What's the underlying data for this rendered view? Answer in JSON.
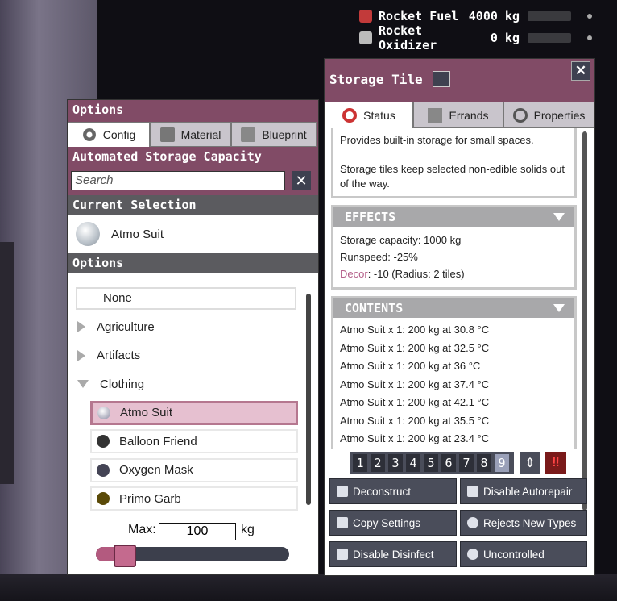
{
  "resources": [
    {
      "name": "Rocket Fuel",
      "value": "4000 kg",
      "icon": "rocket-fuel-icon"
    },
    {
      "name": "Rocket Oxidizer",
      "value": "0 kg",
      "icon": "rocket-oxidizer-icon"
    }
  ],
  "options_panel": {
    "title": "Options",
    "tabs": [
      {
        "label": "Config",
        "icon": "gear-icon"
      },
      {
        "label": "Material",
        "icon": "material-icon"
      },
      {
        "label": "Blueprint",
        "icon": "blueprint-icon"
      }
    ],
    "section_title": "Automated Storage Capacity",
    "search_placeholder": "Search",
    "current_selection_header": "Current Selection",
    "current_selection": "Atmo Suit",
    "options_header": "Options",
    "list": {
      "none": "None",
      "categories": [
        {
          "label": "Agriculture",
          "expanded": false
        },
        {
          "label": "Artifacts",
          "expanded": false
        },
        {
          "label": "Clothing",
          "expanded": true
        }
      ],
      "clothing_items": [
        {
          "label": "Atmo Suit",
          "selected": true,
          "color": "#c8d0d8"
        },
        {
          "label": "Balloon Friend",
          "selected": false,
          "color": "#444"
        },
        {
          "label": "Oxygen Mask",
          "selected": false,
          "color": "#556"
        },
        {
          "label": "Primo Garb",
          "selected": false,
          "color": "#6a5a10"
        }
      ]
    },
    "max_label": "Max:",
    "max_value": "100",
    "max_unit": "kg",
    "slider_level": 0.1
  },
  "storage_tile": {
    "title": "Storage Tile",
    "tabs": [
      {
        "label": "Status",
        "icon": "lifebuoy-icon"
      },
      {
        "label": "Errands",
        "icon": "errands-icon"
      },
      {
        "label": "Properties",
        "icon": "magnifier-icon"
      }
    ],
    "description_1": "Provides built-in storage for small spaces.",
    "description_2": "Storage tiles keep selected non-edible solids out of the way.",
    "effects_header": "EFFECTS",
    "effects": {
      "capacity": "Storage capacity: 1000 kg",
      "runspeed": "Runspeed: -25%",
      "decor_label": "Decor",
      "decor_value": ": -10 (Radius: 2 tiles)"
    },
    "contents_header": "CONTENTS",
    "contents": [
      "Atmo Suit x 1: 200 kg at 30.8 °C",
      "Atmo Suit x 1: 200 kg at 32.5 °C",
      "Atmo Suit x 1: 200 kg at 36 °C",
      "Atmo Suit x 1: 200 kg at 37.4 °C",
      "Atmo Suit x 1: 200 kg at 42.1 °C",
      "Atmo Suit x 1: 200 kg at 35.5 °C",
      "Atmo Suit x 1: 200 kg at 23.4 °C"
    ],
    "priorities": [
      "1",
      "2",
      "3",
      "4",
      "5",
      "6",
      "7",
      "8",
      "9"
    ],
    "selected_priority": "9",
    "actions": [
      {
        "label": "Deconstruct",
        "icon": "deconstruct-icon"
      },
      {
        "label": "Disable Autorepair",
        "icon": "wrench-icon"
      },
      {
        "label": "Copy Settings",
        "icon": "copy-icon"
      },
      {
        "label": "Rejects New Types",
        "icon": "reject-icon"
      },
      {
        "label": "Disable Disinfect",
        "icon": "spray-icon"
      },
      {
        "label": "Uncontrolled",
        "icon": "hand-icon"
      }
    ]
  }
}
